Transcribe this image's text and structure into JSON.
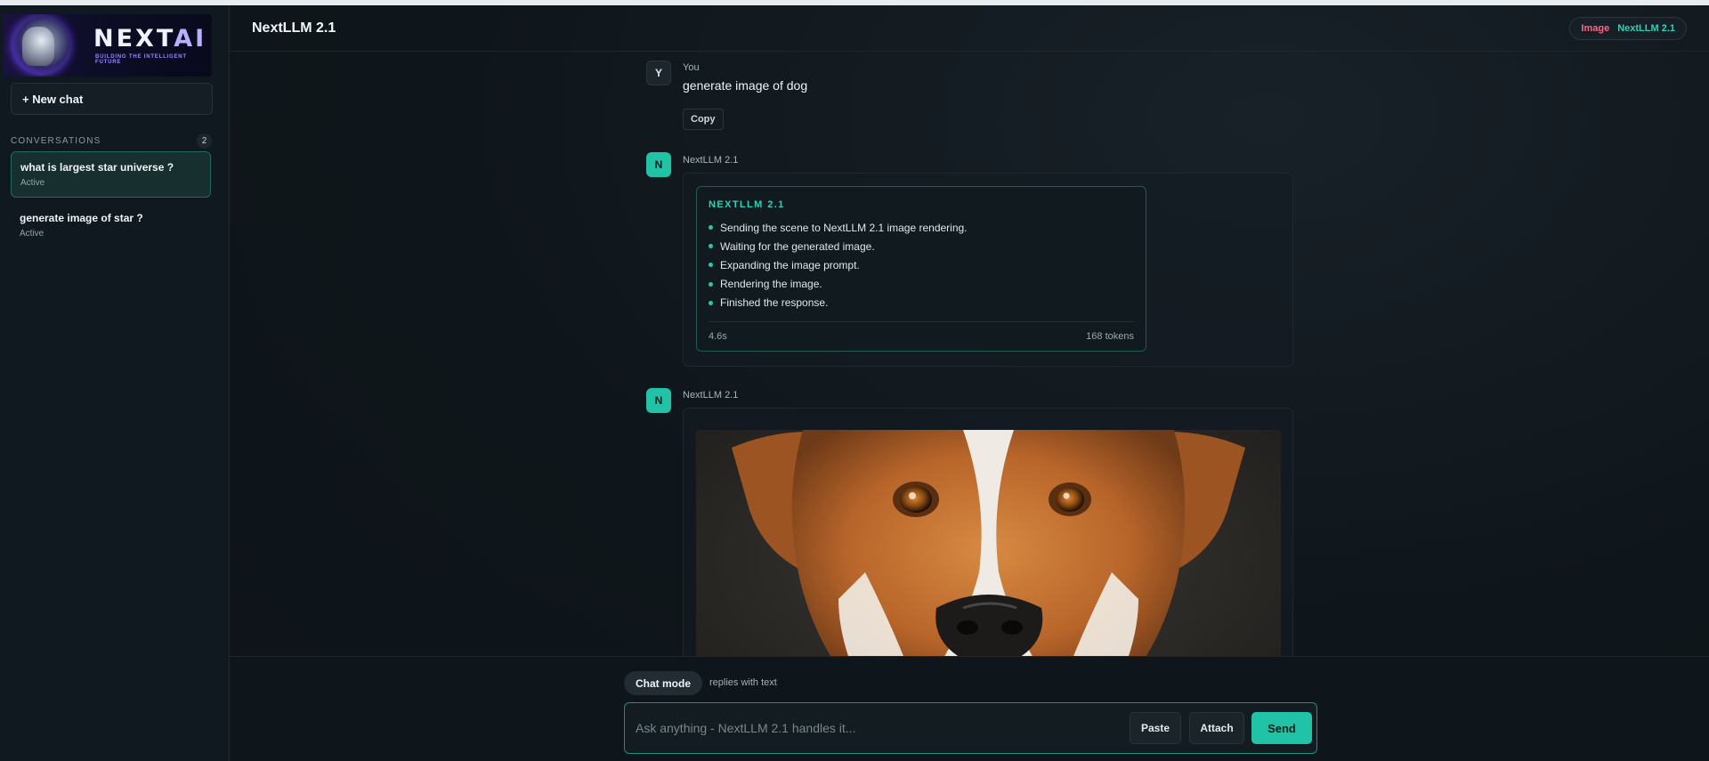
{
  "app": {
    "logo_text": "NEXTAI",
    "logo_tagline": "BUILDING THE INTELLIGENT FUTURE"
  },
  "sidebar": {
    "new_chat_label": "+ New chat",
    "conversations_label": "CONVERSATIONS",
    "conversations_count": "2",
    "items": [
      {
        "title": "what is largest star universe ?",
        "status": "Active"
      },
      {
        "title": "generate image of star ?",
        "status": "Active"
      }
    ]
  },
  "header": {
    "title": "NextLLM 2.1",
    "badge_mode": "Image",
    "badge_model": "NextLLM 2.1"
  },
  "feed": {
    "user_avatar": "Y",
    "user_name": "You",
    "user_message": "generate image of dog",
    "copy_label": "Copy",
    "bot_avatar": "N",
    "bot_name": "NextLLM 2.1",
    "status_card": {
      "heading": "NEXTLLM 2.1",
      "steps": [
        "Sending the scene to NextLLM 2.1 image rendering.",
        "Waiting for the generated image.",
        "Expanding the image prompt.",
        "Rendering the image.",
        "Finished the response."
      ],
      "duration": "4.6s",
      "tokens": "168 tokens"
    },
    "image_reply_name": "NextLLM 2.1"
  },
  "composer": {
    "mode_label": "Chat mode",
    "mode_hint": "replies with text",
    "placeholder": "Ask anything - NextLLM 2.1 handles it...",
    "paste_label": "Paste",
    "attach_label": "Attach",
    "send_label": "Send"
  },
  "colors": {
    "accent": "#20c3a5",
    "accent_text": "#2fd1b6",
    "image_badge": "#f06a86",
    "background": "#0e1419"
  }
}
